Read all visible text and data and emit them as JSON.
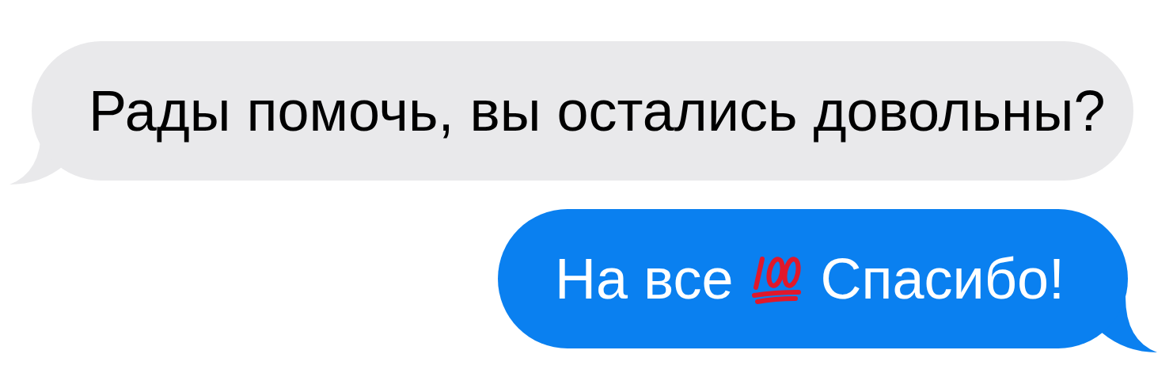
{
  "messages": [
    {
      "kind": "incoming",
      "parts": [
        {
          "kind": "text",
          "text": "Рады помочь, вы остались довольны?"
        }
      ]
    },
    {
      "kind": "outgoing",
      "parts": [
        {
          "kind": "text",
          "text": "На все"
        },
        {
          "kind": "emoji"
        },
        {
          "kind": "text",
          "text": "Спасибо!"
        }
      ]
    }
  ]
}
